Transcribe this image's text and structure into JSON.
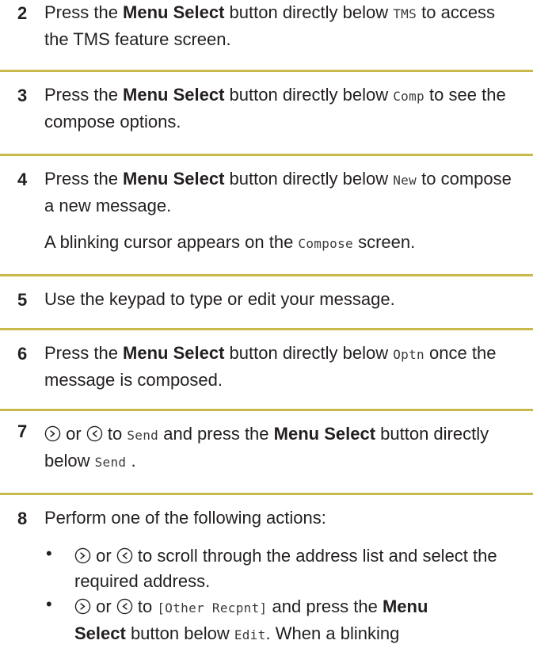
{
  "steps": [
    {
      "num": "2",
      "a": "Press the ",
      "bold": "Menu Select",
      "b": " button directly below ",
      "code": "TMS",
      "c": " to access the TMS feature screen."
    },
    {
      "num": "3",
      "a": "Press the ",
      "bold": "Menu Select",
      "b": " button directly below ",
      "code": "Comp",
      "c": " to see the compose options."
    },
    {
      "num": "4",
      "a": "Press the ",
      "bold": "Menu Select",
      "b": " button directly below ",
      "code": "New",
      "c": " to compose a new message.",
      "note_a": "A blinking cursor appears on the ",
      "note_code": "Compose",
      "note_b": " screen."
    },
    {
      "num": "5",
      "text": "Use the keypad to type or edit your message."
    },
    {
      "num": "6",
      "a": "Press the ",
      "bold": "Menu Select",
      "b": " button directly below ",
      "code": "Optn",
      "c": " once the message is composed."
    },
    {
      "num": "7",
      "or": " or ",
      "to": " to ",
      "code": "Send",
      "mid": " and press the ",
      "bold": "Menu Select",
      "b": " button directly below ",
      "code2": "Send",
      "end": " ."
    },
    {
      "num": "8",
      "text": "Perform one of the following actions:"
    }
  ],
  "bullets": [
    {
      "dot": "•",
      "or": " or ",
      "rest": " to scroll through the address list and select the required address."
    },
    {
      "dot": "•",
      "or": " or ",
      "to": " to ",
      "code": "[Other Recpnt]",
      "mid": " and press the ",
      "bold1": "Menu",
      "bold2": "Select",
      "b": " button below ",
      "code2": "Edit",
      "end": ". When a blinking"
    }
  ],
  "colors": {
    "separator": "#c8b94a",
    "text": "#231f20"
  },
  "icons": [
    "scroll-right-icon",
    "scroll-left-icon"
  ]
}
